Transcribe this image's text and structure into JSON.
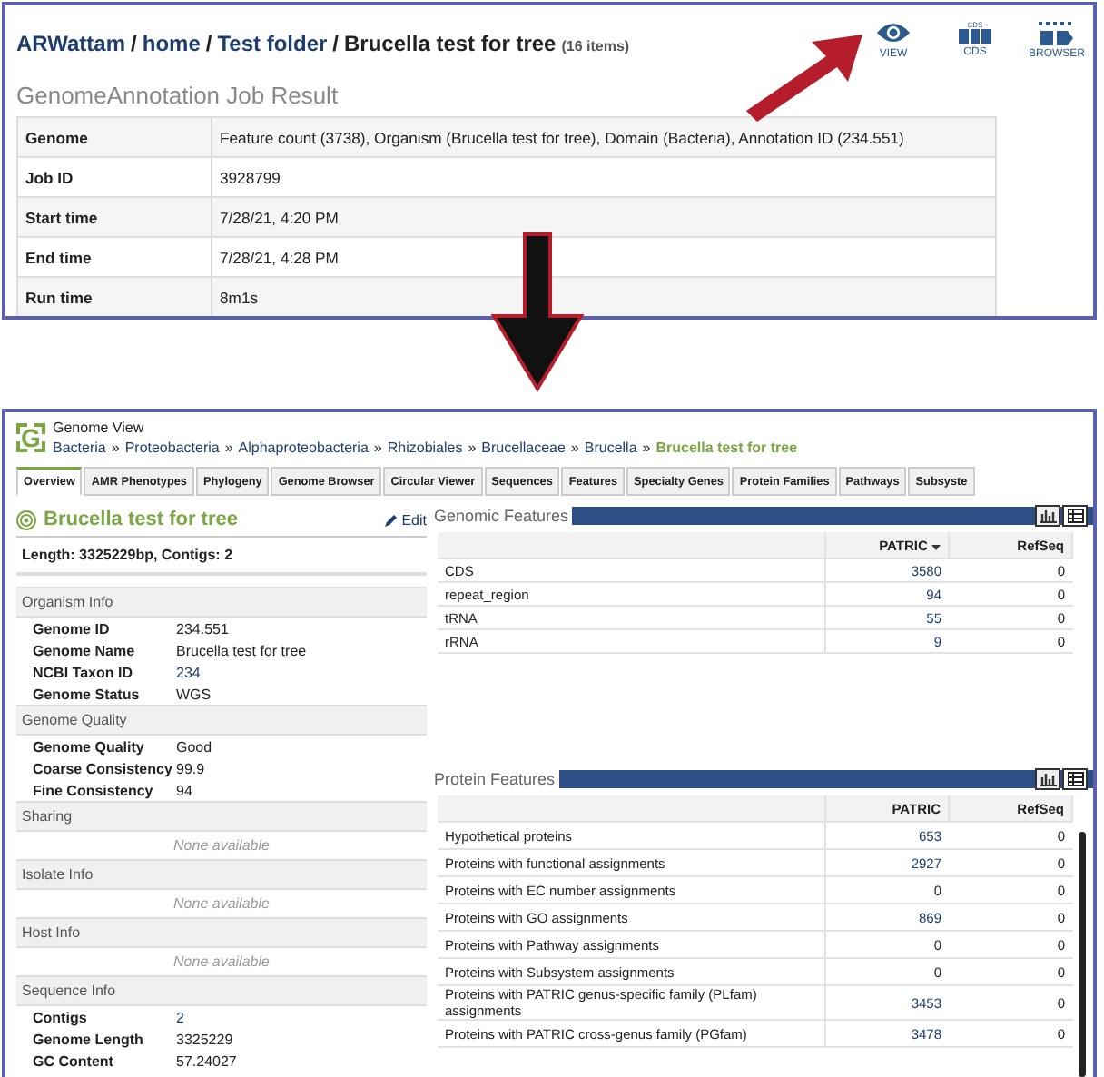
{
  "folder": {
    "path": [
      {
        "label": "ARWattam"
      },
      {
        "label": "home"
      },
      {
        "label": "Test folder"
      }
    ],
    "separator": "/",
    "current": "Brucella test for tree",
    "count": "(16 items)",
    "actions": [
      {
        "kind": "eye",
        "label": "VIEW"
      },
      {
        "kind": "cds",
        "label": "CDS",
        "icon_text": "CDS"
      },
      {
        "kind": "browser",
        "label": "BROWSER"
      }
    ]
  },
  "job_result": {
    "title": "GenomeAnnotation Job Result",
    "rows": [
      {
        "label": "Genome",
        "value": "Feature count (3738), Organism (Brucella test for tree), Domain (Bacteria), Annotation ID (234.551)"
      },
      {
        "label": "Job ID",
        "value": "3928799"
      },
      {
        "label": "Start time",
        "value": "7/28/21, 4:20 PM"
      },
      {
        "label": "End time",
        "value": "7/28/21, 4:28 PM"
      },
      {
        "label": "Run time",
        "value": "8m1s"
      }
    ]
  },
  "genome_view": {
    "logo": "G",
    "title": "Genome View",
    "separator": "»",
    "breadcrumb": [
      {
        "label": "Bacteria"
      },
      {
        "label": "Proteobacteria"
      },
      {
        "label": "Alphaproteobacteria"
      },
      {
        "label": "Rhizobiales"
      },
      {
        "label": "Brucellaceae"
      },
      {
        "label": "Brucella"
      }
    ],
    "current": "Brucella test for tree",
    "tabs": [
      {
        "label": "Overview",
        "selected": true
      },
      {
        "label": "AMR Phenotypes",
        "selected": false
      },
      {
        "label": "Phylogeny",
        "selected": false
      },
      {
        "label": "Genome Browser",
        "selected": false
      },
      {
        "label": "Circular Viewer",
        "selected": false
      },
      {
        "label": "Sequences",
        "selected": false
      },
      {
        "label": "Features",
        "selected": false
      },
      {
        "label": "Specialty Genes",
        "selected": false
      },
      {
        "label": "Protein Families",
        "selected": false
      },
      {
        "label": "Pathways",
        "selected": false
      },
      {
        "label": "Subsyste",
        "selected": false
      }
    ],
    "overview": {
      "name": "Brucella test for tree",
      "edit": "Edit",
      "summary": "Length: 3325229bp, Contigs: 2",
      "sections": [
        {
          "title": "Organism Info",
          "rows": [
            {
              "label": "Genome ID",
              "value": "234.551",
              "link": false
            },
            {
              "label": "Genome Name",
              "value": "Brucella test for tree",
              "link": false
            },
            {
              "label": "NCBI Taxon ID",
              "value": "234",
              "link": true
            },
            {
              "label": "Genome Status",
              "value": "WGS",
              "link": false
            }
          ]
        },
        {
          "title": "Genome Quality",
          "rows": [
            {
              "label": "Genome Quality",
              "value": "Good",
              "link": false
            },
            {
              "label": "Coarse Consistency",
              "value": "99.9",
              "link": false
            },
            {
              "label": "Fine Consistency",
              "value": "94",
              "link": false
            }
          ]
        },
        {
          "title": "Sharing",
          "empty": "None available"
        },
        {
          "title": "Isolate Info",
          "empty": "None available"
        },
        {
          "title": "Host Info",
          "empty": "None available"
        },
        {
          "title": "Sequence Info",
          "rows": [
            {
              "label": "Contigs",
              "value": "2",
              "link": true
            },
            {
              "label": "Genome Length",
              "value": "3325229",
              "link": false
            },
            {
              "label": "GC Content",
              "value": "57.24027",
              "link": false
            }
          ]
        }
      ]
    },
    "genomic_features": {
      "title": "Genomic Features",
      "columns": [
        {
          "label": "PATRIC",
          "sorted": true
        },
        {
          "label": "RefSeq",
          "sorted": false
        }
      ],
      "rows": [
        {
          "name": "CDS",
          "patric": "3580",
          "refseq": "0",
          "link": true
        },
        {
          "name": "repeat_region",
          "patric": "94",
          "refseq": "0",
          "link": true
        },
        {
          "name": "tRNA",
          "patric": "55",
          "refseq": "0",
          "link": true
        },
        {
          "name": "rRNA",
          "patric": "9",
          "refseq": "0",
          "link": true
        }
      ]
    },
    "protein_features": {
      "title": "Protein Features",
      "columns": [
        {
          "label": "PATRIC",
          "sorted": false
        },
        {
          "label": "RefSeq",
          "sorted": false
        }
      ],
      "rows": [
        {
          "name": "Hypothetical proteins",
          "patric": "653",
          "refseq": "0",
          "link": true
        },
        {
          "name": "Proteins with functional assignments",
          "patric": "2927",
          "refseq": "0",
          "link": true
        },
        {
          "name": "Proteins with EC number assignments",
          "patric": "0",
          "refseq": "0",
          "link": false
        },
        {
          "name": "Proteins with GO assignments",
          "patric": "869",
          "refseq": "0",
          "link": true
        },
        {
          "name": "Proteins with Pathway assignments",
          "patric": "0",
          "refseq": "0",
          "link": false
        },
        {
          "name": "Proteins with Subsystem assignments",
          "patric": "0",
          "refseq": "0",
          "link": false
        },
        {
          "name": "Proteins with PATRIC genus-specific family (PLfam) assignments",
          "patric": "3453",
          "refseq": "0",
          "link": true
        },
        {
          "name": "Proteins with PATRIC cross-genus family (PGfam)",
          "patric": "3478",
          "refseq": "0",
          "link": true
        }
      ]
    }
  }
}
